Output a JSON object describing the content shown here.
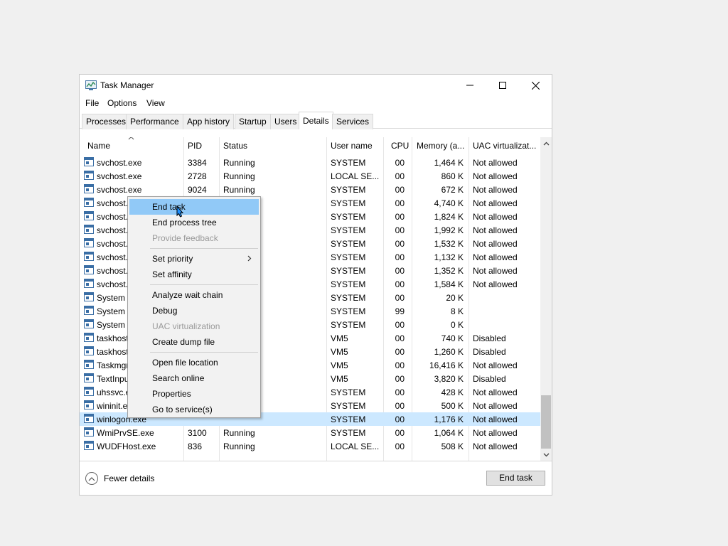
{
  "window": {
    "title": "Task Manager"
  },
  "menu": [
    "File",
    "Options",
    "View"
  ],
  "tabs": [
    "Processes",
    "Performance",
    "App history",
    "Startup",
    "Users",
    "Details",
    "Services"
  ],
  "columns": [
    "Name",
    "PID",
    "Status",
    "User name",
    "CPU",
    "Memory (a...",
    "UAC virtualizat..."
  ],
  "rows": [
    {
      "name": "svchost.exe",
      "pid": "3384",
      "status": "Running",
      "user": "SYSTEM",
      "cpu": "00",
      "mem": "1,464 K",
      "uac": "Not allowed"
    },
    {
      "name": "svchost.exe",
      "pid": "2728",
      "status": "Running",
      "user": "LOCAL SE...",
      "cpu": "00",
      "mem": "860 K",
      "uac": "Not allowed"
    },
    {
      "name": "svchost.exe",
      "pid": "9024",
      "status": "Running",
      "user": "SYSTEM",
      "cpu": "00",
      "mem": "672 K",
      "uac": "Not allowed"
    },
    {
      "name": "svchost.",
      "pid": "",
      "status": "",
      "user": "SYSTEM",
      "cpu": "00",
      "mem": "4,740 K",
      "uac": "Not allowed"
    },
    {
      "name": "svchost.",
      "pid": "",
      "status": "",
      "user": "SYSTEM",
      "cpu": "00",
      "mem": "1,824 K",
      "uac": "Not allowed"
    },
    {
      "name": "svchost.",
      "pid": "",
      "status": "",
      "user": "SYSTEM",
      "cpu": "00",
      "mem": "1,992 K",
      "uac": "Not allowed"
    },
    {
      "name": "svchost.",
      "pid": "",
      "status": "",
      "user": "SYSTEM",
      "cpu": "00",
      "mem": "1,532 K",
      "uac": "Not allowed"
    },
    {
      "name": "svchost.",
      "pid": "",
      "status": "",
      "user": "SYSTEM",
      "cpu": "00",
      "mem": "1,132 K",
      "uac": "Not allowed"
    },
    {
      "name": "svchost.",
      "pid": "",
      "status": "",
      "user": "SYSTEM",
      "cpu": "00",
      "mem": "1,352 K",
      "uac": "Not allowed"
    },
    {
      "name": "svchost.",
      "pid": "",
      "status": "",
      "user": "SYSTEM",
      "cpu": "00",
      "mem": "1,584 K",
      "uac": "Not allowed"
    },
    {
      "name": "System",
      "pid": "",
      "status": "",
      "user": "SYSTEM",
      "cpu": "00",
      "mem": "20 K",
      "uac": ""
    },
    {
      "name": "System I",
      "pid": "",
      "status": "",
      "user": "SYSTEM",
      "cpu": "99",
      "mem": "8 K",
      "uac": ""
    },
    {
      "name": "System i",
      "pid": "",
      "status": "",
      "user": "SYSTEM",
      "cpu": "00",
      "mem": "0 K",
      "uac": ""
    },
    {
      "name": "taskhost",
      "pid": "",
      "status": "",
      "user": "VM5",
      "cpu": "00",
      "mem": "740 K",
      "uac": "Disabled"
    },
    {
      "name": "taskhost",
      "pid": "",
      "status": "",
      "user": "VM5",
      "cpu": "00",
      "mem": "1,260 K",
      "uac": "Disabled"
    },
    {
      "name": "Taskmgr",
      "pid": "",
      "status": "",
      "user": "VM5",
      "cpu": "00",
      "mem": "16,416 K",
      "uac": "Not allowed"
    },
    {
      "name": "TextInpu",
      "pid": "",
      "status": "",
      "user": "VM5",
      "cpu": "00",
      "mem": "3,820 K",
      "uac": "Disabled"
    },
    {
      "name": "uhssvc.e",
      "pid": "",
      "status": "",
      "user": "SYSTEM",
      "cpu": "00",
      "mem": "428 K",
      "uac": "Not allowed"
    },
    {
      "name": "wininit.e",
      "pid": "",
      "status": "",
      "user": "SYSTEM",
      "cpu": "00",
      "mem": "500 K",
      "uac": "Not allowed"
    },
    {
      "name": "winlogon.exe",
      "pid": "",
      "status": "",
      "user": "SYSTEM",
      "cpu": "00",
      "mem": "1,176 K",
      "uac": "Not allowed"
    },
    {
      "name": "WmiPrvSE.exe",
      "pid": "3100",
      "status": "Running",
      "user": "SYSTEM",
      "cpu": "00",
      "mem": "1,064 K",
      "uac": "Not allowed"
    },
    {
      "name": "WUDFHost.exe",
      "pid": "836",
      "status": "Running",
      "user": "LOCAL SE...",
      "cpu": "00",
      "mem": "508 K",
      "uac": "Not allowed"
    }
  ],
  "context_menu": {
    "end_task": "End task",
    "end_process_tree": "End process tree",
    "provide_feedback": "Provide feedback",
    "set_priority": "Set priority",
    "set_affinity": "Set affinity",
    "analyze_wait_chain": "Analyze wait chain",
    "debug": "Debug",
    "uac_virtualization": "UAC virtualization",
    "create_dump_file": "Create dump file",
    "open_file_location": "Open file location",
    "search_online": "Search online",
    "properties": "Properties",
    "go_to_services": "Go to service(s)"
  },
  "footer": {
    "fewer_details": "Fewer details",
    "end_task": "End task"
  },
  "colors": {
    "selected_row": "#cce8ff",
    "menu_highlight": "#91c9f7",
    "disabled_text": "#9a9a9a"
  }
}
